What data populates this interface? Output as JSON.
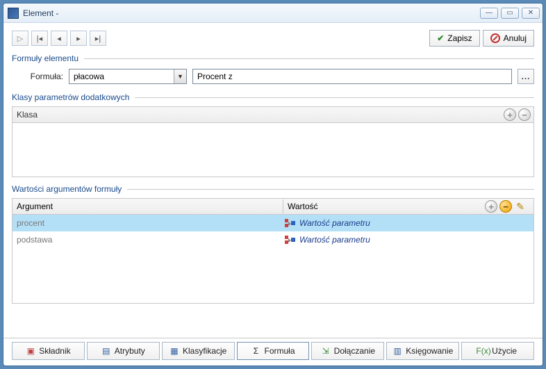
{
  "window": {
    "title": "Element -"
  },
  "toolbar": {
    "save_label": "Zapisz",
    "cancel_label": "Anuluj"
  },
  "sections": {
    "formulas": "Formuły elementu",
    "formula_label": "Formuła:",
    "formula_type": "płacowa",
    "formula_name": "Procent z",
    "klasy": "Klasy parametrów dodatkowych",
    "klasa_col": "Klasa",
    "wartosci": "Wartości argumentów formuły",
    "arg_col": "Argument",
    "val_col": "Wartość"
  },
  "arguments": [
    {
      "name": "procent",
      "value": "Wartość parametru"
    },
    {
      "name": "podstawa",
      "value": "Wartość parametru"
    }
  ],
  "tabs": {
    "skladnik": "Składnik",
    "atrybuty": "Atrybuty",
    "klasyfikacje": "Klasyfikacje",
    "formula": "Formuła",
    "dolaczanie": "Dołączanie",
    "ksiegowanie": "Księgowanie",
    "uzycie": "Użycie"
  },
  "more": "..."
}
